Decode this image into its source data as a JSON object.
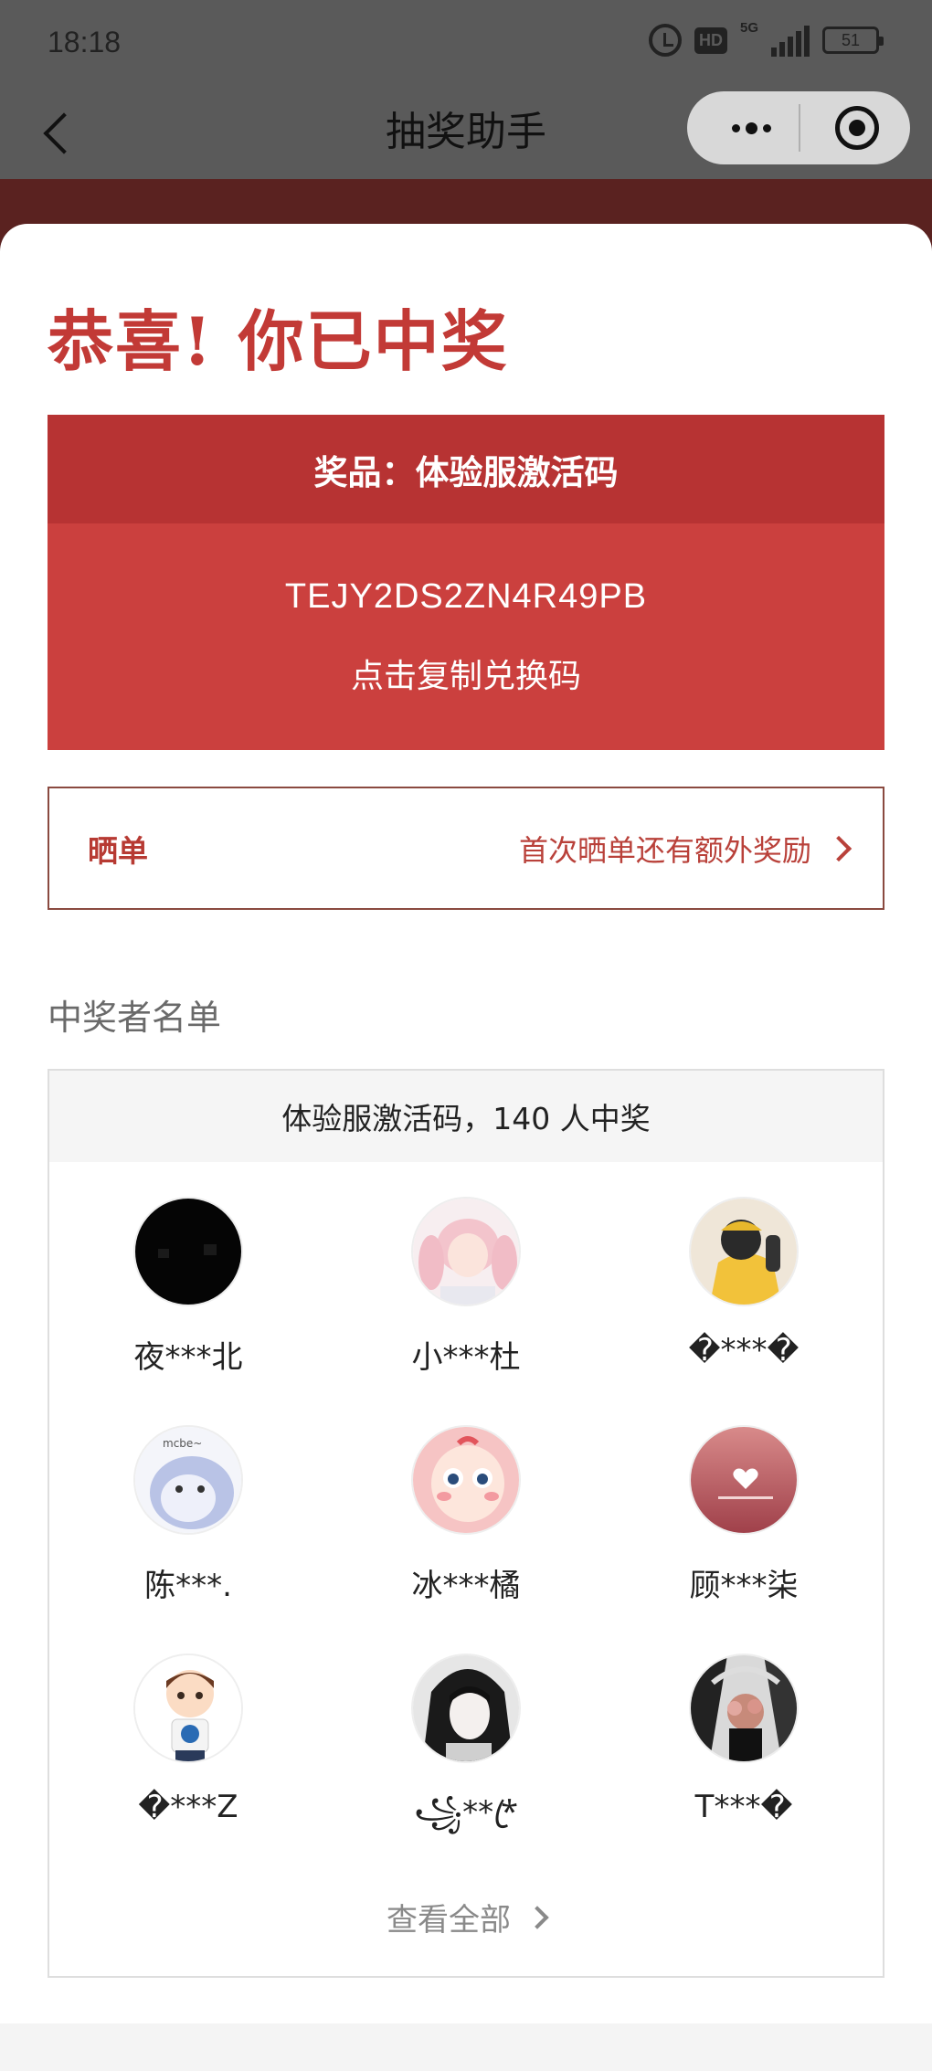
{
  "status": {
    "time": "18:18",
    "network": "5G",
    "hd": "HD",
    "battery": "51"
  },
  "nav": {
    "title": "抽奖助手"
  },
  "congrats": "恭喜! 你已中奖",
  "prize": {
    "header": "奖品：体验服激活码",
    "code": "TEJY2DS2ZN4R49PB",
    "copy_label": "点击复制兑换码"
  },
  "share": {
    "label": "晒单",
    "hint": "首次晒单还有额外奖励"
  },
  "winners": {
    "section_title": "中奖者名单",
    "summary": "体验服激活码，140 人中奖",
    "list": [
      {
        "name": "夜***北"
      },
      {
        "name": "小***杜"
      },
      {
        "name": "�***�"
      },
      {
        "name": "陈***."
      },
      {
        "name": "冰***橘"
      },
      {
        "name": "顾***柒"
      },
      {
        "name": "�***Z"
      },
      {
        "name": "꧁***ꦿ"
      },
      {
        "name": "T***�"
      }
    ],
    "view_all": "查看全部"
  },
  "colors": {
    "accent_red": "#c23a36",
    "prize_header": "#b73333",
    "prize_body": "#cb403e"
  }
}
